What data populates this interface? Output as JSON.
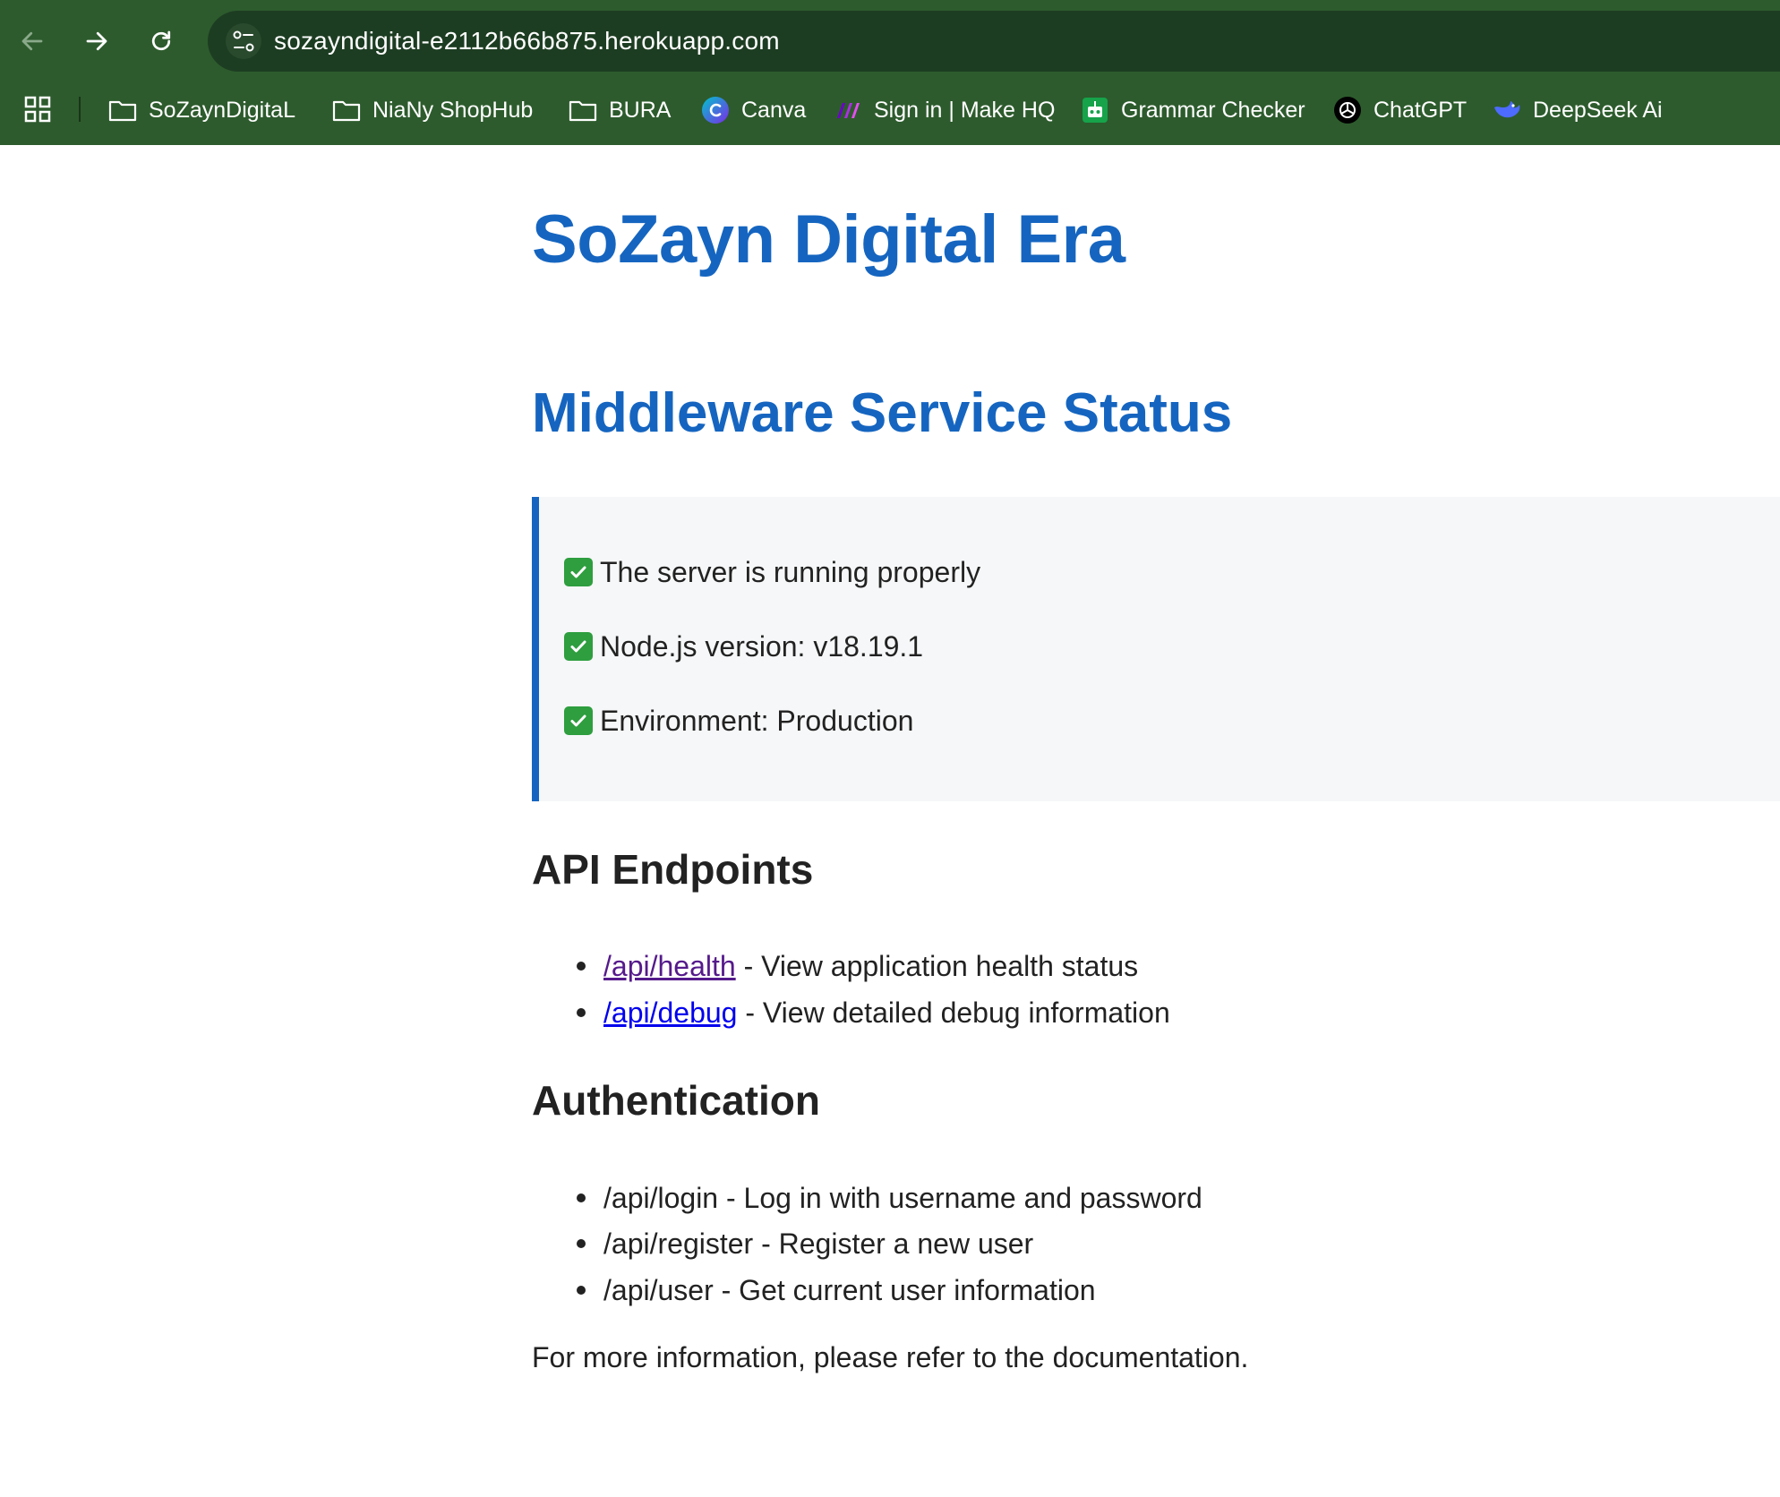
{
  "browser": {
    "url": "sozayndigital-e2112b66b875.herokuapp.com",
    "bookmarks": [
      {
        "label": "SoZaynDigitaL",
        "icon": "folder-icon"
      },
      {
        "label": "NiaNy ShopHub",
        "icon": "folder-icon"
      },
      {
        "label": "BURA",
        "icon": "folder-icon"
      },
      {
        "label": "Canva",
        "icon": "canva-icon"
      },
      {
        "label": "Sign in | Make HQ",
        "icon": "make-icon"
      },
      {
        "label": "Grammar Checker",
        "icon": "grammar-checker-icon"
      },
      {
        "label": "ChatGPT",
        "icon": "chatgpt-icon"
      },
      {
        "label": "DeepSeek Ai",
        "icon": "deepseek-icon"
      }
    ]
  },
  "page": {
    "title": "SoZayn Digital Era",
    "subtitle": "Middleware Service Status",
    "status": [
      "The server is running properly",
      "Node.js version: v18.19.1",
      "Environment: Production"
    ],
    "api_section": {
      "heading": "API Endpoints",
      "items": [
        {
          "link": "/api/health",
          "desc": " - View application health status",
          "visited": true
        },
        {
          "link": "/api/debug",
          "desc": " - View detailed debug information",
          "visited": false
        }
      ]
    },
    "auth_section": {
      "heading": "Authentication",
      "items": [
        "/api/login - Log in with username and password",
        "/api/register - Register a new user",
        "/api/user - Get current user information"
      ]
    },
    "footer": "For more information, please refer to the documentation."
  },
  "colors": {
    "chrome_bg": "#2d5b2d",
    "heading_blue": "#1565c0",
    "status_bg": "#f6f7f8",
    "check_green": "#2e9e3f"
  }
}
